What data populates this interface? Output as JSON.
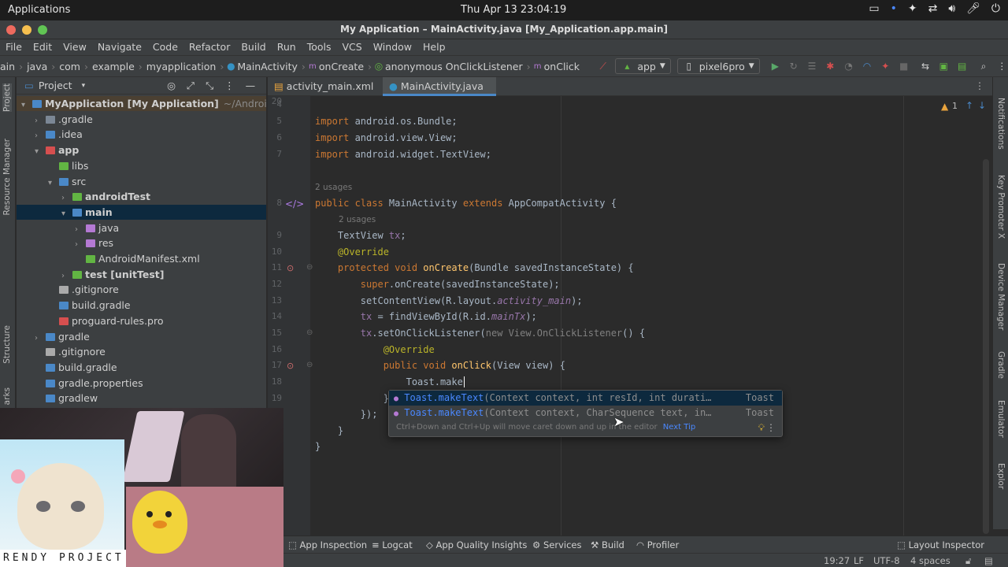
{
  "system_bar": {
    "apps_label": "Applications",
    "clock": "Thu Apr 13  23:04:19"
  },
  "window": {
    "title": "My Application – MainActivity.java [My_Application.app.main]"
  },
  "menu": [
    "File",
    "Edit",
    "View",
    "Navigate",
    "Code",
    "Refactor",
    "Build",
    "Run",
    "Tools",
    "VCS",
    "Window",
    "Help"
  ],
  "breadcrumb": [
    "ain",
    "java",
    "com",
    "example",
    "myapplication",
    "MainActivity",
    "onCreate",
    "anonymous OnClickListener",
    "onClick"
  ],
  "toolbar": {
    "run_config": "app",
    "device": "pixel6pro"
  },
  "left_strip": {
    "project": "Project",
    "resource_manager": "Resource Manager",
    "structure": "Structure",
    "bookmarks": "arks"
  },
  "right_strip": {
    "notifications": "Notifications",
    "key_promoter": "Key Promoter X",
    "device_manager": "Device Manager",
    "gradle": "Gradle",
    "emulator": "Emulator",
    "device_file_explorer": "Device File Explor"
  },
  "project_panel": {
    "header": "Project",
    "tree": [
      {
        "label": "MyApplication [My Application]",
        "extra": "~/AndroidStudio",
        "level": 0,
        "arrow": "down",
        "bold": true
      },
      {
        "label": ".gradle",
        "level": 1,
        "arrow": "right"
      },
      {
        "label": ".idea",
        "level": 1,
        "arrow": "right"
      },
      {
        "label": "app",
        "level": 1,
        "arrow": "down",
        "bold": true
      },
      {
        "label": "libs",
        "level": 2,
        "arrow": ""
      },
      {
        "label": "src",
        "level": 2,
        "arrow": "down"
      },
      {
        "label": "androidTest",
        "level": 3,
        "arrow": "right",
        "bold": true
      },
      {
        "label": "main",
        "level": 3,
        "arrow": "down",
        "bold": true
      },
      {
        "label": "java",
        "level": 4,
        "arrow": "right"
      },
      {
        "label": "res",
        "level": 4,
        "arrow": "right"
      },
      {
        "label": "AndroidManifest.xml",
        "level": 4,
        "arrow": ""
      },
      {
        "label": "test [unitTest]",
        "level": 3,
        "arrow": "right",
        "bold": true
      },
      {
        "label": ".gitignore",
        "level": 2,
        "arrow": ""
      },
      {
        "label": "build.gradle",
        "level": 2,
        "arrow": ""
      },
      {
        "label": "proguard-rules.pro",
        "level": 2,
        "arrow": ""
      },
      {
        "label": "gradle",
        "level": 1,
        "arrow": "right"
      },
      {
        "label": ".gitignore",
        "level": 1,
        "arrow": ""
      },
      {
        "label": "build.gradle",
        "level": 1,
        "arrow": ""
      },
      {
        "label": "gradle.properties",
        "level": 1,
        "arrow": ""
      },
      {
        "label": "gradlew",
        "level": 1,
        "arrow": ""
      }
    ]
  },
  "tabs": [
    {
      "label": "activity_main.xml"
    },
    {
      "label": "MainActivity.java"
    }
  ],
  "editor": {
    "warning_count": "1",
    "line_numbers": [
      "4",
      "5",
      "6",
      "7",
      "",
      "8",
      "9",
      "",
      "10",
      "11",
      "12",
      "13",
      "14",
      "15",
      "16",
      "17",
      "18",
      "19",
      "20",
      "",
      "",
      ""
    ],
    "usages_1": "2 usages",
    "usages_2": "2 usages",
    "typed": "Toast.make"
  },
  "completion": {
    "rows": [
      {
        "method": "Toast.makeText",
        "params": "(Context context, int resId, int durati…",
        "type": "Toast"
      },
      {
        "method": "Toast.makeText",
        "params": "(Context context, CharSequence text, in…",
        "type": "Toast"
      }
    ],
    "tip": "Ctrl+Down and Ctrl+Up will move caret down and up in the editor",
    "next_tip": "Next Tip"
  },
  "bottom_tools": [
    "App Inspection",
    "Logcat",
    "App Quality Insights",
    "Services",
    "Build",
    "Profiler"
  ],
  "layout_inspector": "Layout Inspector",
  "status": {
    "position": "19:27",
    "line_sep": "LF",
    "encoding": "UTF-8",
    "indent": "4 spaces"
  },
  "webcam": {
    "caption": "RENDY PROJECT"
  }
}
